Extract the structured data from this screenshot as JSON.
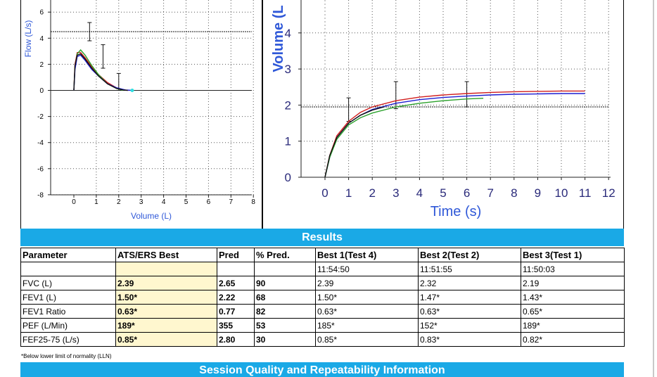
{
  "chart_data": [
    {
      "type": "line",
      "title": "",
      "xlabel": "Volume (L)",
      "ylabel": "Flow (L/s)",
      "xlim": [
        -1,
        8
      ],
      "ylim": [
        -8,
        6
      ],
      "x_ticks": [
        0,
        1,
        2,
        3,
        4,
        5,
        6,
        7,
        8
      ],
      "y_ticks": [
        -8,
        -6,
        -4,
        -2,
        0,
        2,
        4,
        6
      ],
      "grid": true,
      "reference_line_y": 4.5,
      "error_bars": [
        {
          "x": 0.7,
          "low": 3.8,
          "high": 5.2
        },
        {
          "x": 1.3,
          "low": 1.7,
          "high": 3.5
        },
        {
          "x": 2.0,
          "low": 0.0,
          "high": 1.3
        }
      ],
      "series": [
        {
          "color": "#d11e1e",
          "x": [
            0,
            0.05,
            0.15,
            0.3,
            0.5,
            0.8,
            1.1,
            1.5,
            1.9,
            2.2,
            2.4
          ],
          "y": [
            0,
            2.0,
            2.9,
            2.9,
            2.5,
            1.8,
            1.2,
            0.6,
            0.2,
            0.05,
            0
          ]
        },
        {
          "color": "#2ba12b",
          "x": [
            0,
            0.05,
            0.15,
            0.3,
            0.5,
            0.8,
            1.1,
            1.5,
            1.9,
            2.2
          ],
          "y": [
            0,
            1.8,
            2.8,
            3.1,
            2.7,
            1.9,
            1.2,
            0.5,
            0.15,
            0
          ]
        },
        {
          "color": "#1e1ed1",
          "x": [
            0,
            0.05,
            0.15,
            0.3,
            0.5,
            0.8,
            1.1,
            1.5,
            1.9,
            2.3,
            2.6
          ],
          "y": [
            0,
            1.6,
            2.6,
            2.7,
            2.3,
            1.6,
            1.1,
            0.5,
            0.2,
            0.03,
            0
          ]
        },
        {
          "color": "#111111",
          "x": [
            0,
            0.05,
            0.15,
            0.3,
            0.5,
            0.8,
            1.1,
            1.5,
            1.9,
            2.2,
            2.4
          ],
          "y": [
            0,
            1.9,
            2.7,
            2.8,
            2.4,
            1.7,
            1.1,
            0.5,
            0.15,
            0.03,
            0
          ]
        }
      ]
    },
    {
      "type": "line",
      "title": "",
      "xlabel": "Time (s)",
      "ylabel": "Volume (L",
      "xlim": [
        -1,
        12
      ],
      "ylim": [
        0,
        5
      ],
      "x_ticks": [
        0,
        1,
        2,
        3,
        4,
        5,
        6,
        7,
        8,
        9,
        10,
        11,
        12
      ],
      "y_ticks": [
        0,
        1,
        2,
        3,
        4
      ],
      "grid": true,
      "reference_line_y": 1.95,
      "error_bars": [
        {
          "x": 1.0,
          "low": 1.55,
          "high": 2.2
        },
        {
          "x": 3.0,
          "low": 1.9,
          "high": 2.65
        },
        {
          "x": 6.0,
          "low": 1.95,
          "high": 2.65
        }
      ],
      "series": [
        {
          "color": "#d11e1e",
          "x": [
            0,
            0.2,
            0.5,
            1,
            1.5,
            2,
            3,
            4,
            5,
            6,
            7,
            8,
            9,
            10,
            11
          ],
          "y": [
            0,
            0.6,
            1.15,
            1.55,
            1.8,
            1.95,
            2.12,
            2.22,
            2.28,
            2.32,
            2.35,
            2.37,
            2.38,
            2.39,
            2.39
          ]
        },
        {
          "color": "#1e1ed1",
          "x": [
            0,
            0.2,
            0.5,
            1,
            1.5,
            2,
            3,
            4,
            5,
            6,
            7,
            8,
            9,
            10,
            11
          ],
          "y": [
            0,
            0.55,
            1.1,
            1.5,
            1.72,
            1.88,
            2.05,
            2.15,
            2.21,
            2.25,
            2.28,
            2.3,
            2.31,
            2.32,
            2.32
          ]
        },
        {
          "color": "#2ba12b",
          "x": [
            0,
            0.2,
            0.5,
            1,
            1.5,
            2,
            3,
            4,
            5,
            6,
            6.7
          ],
          "y": [
            0,
            0.55,
            1.05,
            1.45,
            1.65,
            1.78,
            1.95,
            2.05,
            2.12,
            2.17,
            2.19
          ]
        },
        {
          "color": "#111111",
          "x": [
            0,
            0.2,
            0.5,
            1,
            1.5,
            2,
            2.5
          ],
          "y": [
            0,
            0.6,
            1.1,
            1.5,
            1.72,
            1.86,
            1.95
          ]
        }
      ]
    }
  ],
  "results": {
    "title": "Results",
    "headers": [
      "Parameter",
      "ATS/ERS Best",
      "Pred",
      "% Pred.",
      "Best 1(Test 4)",
      "Best 2(Test 2)",
      "Best 3(Test 1)"
    ],
    "time_row": [
      "",
      "",
      "",
      "",
      "11:54:50",
      "11:51:55",
      "11:50:03"
    ],
    "rows": [
      [
        "FVC (L)",
        "2.39",
        "2.65",
        "90",
        "2.39",
        "2.32",
        "2.19"
      ],
      [
        "FEV1 (L)",
        "1.50*",
        "2.22",
        "68",
        "1.50*",
        "1.47*",
        "1.43*"
      ],
      [
        "FEV1 Ratio",
        "0.63*",
        "0.77",
        "82",
        "0.63*",
        "0.63*",
        "0.65*"
      ],
      [
        "PEF (L/Min)",
        "189*",
        "355",
        "53",
        "185*",
        "152*",
        "189*"
      ],
      [
        "FEF25-75 (L/s)",
        "0.85*",
        "2.80",
        "30",
        "0.85*",
        "0.83*",
        "0.82*"
      ]
    ],
    "footnote": "*Below lower limit of normality (LLN)"
  },
  "session": {
    "title": "Session Quality and Repeatability Information"
  },
  "colors": {
    "band": "#1aa9e6",
    "best_highlight": "#fff7cf",
    "axis_label": "#2f58d8"
  }
}
